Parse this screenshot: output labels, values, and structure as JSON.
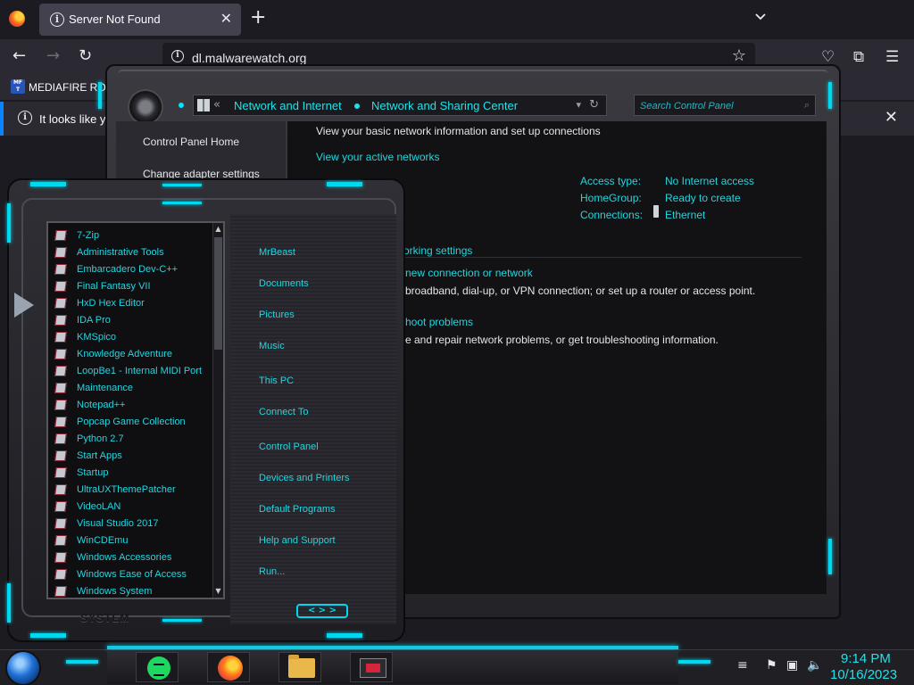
{
  "browser": {
    "tab_title": "Server Not Found",
    "url": "dl.malwarewatch.org",
    "bookmark_icon_text": "MF T",
    "bookmark_label": "MEDIAFIRE RO",
    "notification_text": "It looks like y"
  },
  "control_panel": {
    "breadcrumb": [
      "Network and Internet",
      "Network and Sharing Center"
    ],
    "search_placeholder": "Search Control Panel",
    "left_links": [
      "Control Panel Home",
      "Change adapter settings"
    ],
    "heading": "View your basic network information and set up connections",
    "active_networks": "View your active networks",
    "access_type_label": "Access type:",
    "access_type_value": "No Internet access",
    "homegroup_label": "HomeGroup:",
    "homegroup_value": "Ready to create",
    "connections_label": "Connections:",
    "connections_value": "Ethernet",
    "change_settings": "orking settings",
    "setup_link": "new connection or network",
    "setup_desc": "broadband, dial-up, or VPN connection; or set up a router or access point.",
    "troubleshoot_link": "hoot problems",
    "troubleshoot_desc": "e and repair network problems, or get troubleshooting information."
  },
  "start_menu": {
    "programs": [
      "7-Zip",
      "Administrative Tools",
      "Embarcadero Dev-C++",
      "Final Fantasy VII",
      "HxD Hex Editor",
      "IDA Pro",
      "KMSpico",
      "Knowledge Adventure",
      "LoopBe1 - Internal MIDI Port",
      "Maintenance",
      "Notepad++",
      "Popcap Game Collection",
      "Python 2.7",
      "Start Apps",
      "Startup",
      "UltraUXThemePatcher",
      "VideoLAN",
      "Visual Studio 2017",
      "WinCDEmu",
      "Windows Accessories",
      "Windows Ease of Access",
      "Windows System"
    ],
    "places": [
      "MrBeast",
      "Documents",
      "Pictures",
      "Music",
      "This PC",
      "Connect To",
      "Control Panel",
      "Devices and Printers",
      "Default Programs",
      "Help and Support",
      "Run..."
    ],
    "system_label": "SYSTEM",
    "shutdown_glyph": "< > >"
  },
  "taskbar": {
    "time": "9:14 PM",
    "date": "10/16/2023",
    "pinned": [
      "spotify-icon",
      "firefox-icon",
      "file-explorer-icon",
      "app-icon"
    ]
  },
  "colors": {
    "accent": "#22d6e0",
    "glow": "#00d8f0",
    "browser_bg": "#1c1b22"
  }
}
